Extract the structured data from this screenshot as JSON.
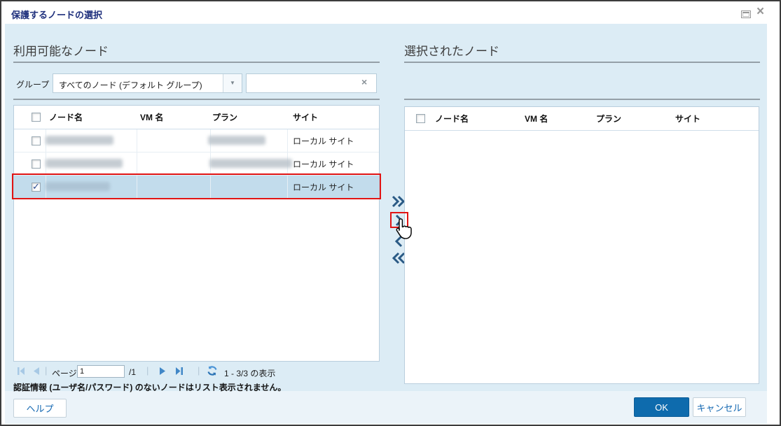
{
  "window": {
    "title": "保護するノードの選択",
    "close_glyph": "×",
    "dropdown_arrow_glyph": "▼",
    "clear_glyph": "×"
  },
  "left_panel": {
    "heading": "利用可能なノード",
    "group_label": "グループ",
    "group_value": "すべてのノード (デフォルト グループ)",
    "filter_value": "",
    "columns": [
      "ノード名",
      "VM 名",
      "プラン",
      "サイト"
    ],
    "rows": [
      {
        "node_name_redacted": true,
        "vm_name": "",
        "plan_redacted": true,
        "site": "ローカル サイト",
        "checked": false,
        "selected": false
      },
      {
        "node_name_redacted": true,
        "vm_name": "",
        "plan_redacted": true,
        "site": "ローカル サイト",
        "checked": false,
        "selected": false
      },
      {
        "node_name_redacted": true,
        "vm_name": "",
        "plan_redacted": false,
        "site": "ローカル サイト",
        "checked": true,
        "selected": true
      }
    ],
    "pagination": {
      "page_label": "ページ",
      "page_value": "1",
      "page_total": "/1",
      "separator": "|",
      "range_text": "1 - 3/3 の表示"
    },
    "note": "認証情報 (ユーザ名/パスワード) のないノードはリスト表示されません。"
  },
  "right_panel": {
    "heading": "選択されたノード",
    "columns": [
      "ノード名",
      "VM 名",
      "プラン",
      "サイト"
    ]
  },
  "footer": {
    "help_label": "ヘルプ",
    "ok_label": "OK",
    "cancel_label": "キャンセル"
  },
  "colors": {
    "title_text": "#1e2f7c",
    "content_bg": "#dcecf5",
    "selected_row_bg": "#c2dcec",
    "highlight_red": "#e11414",
    "primary_button": "#0e6bad",
    "link_blue": "#1468b2",
    "arrow_blue": "#2a5a85"
  }
}
